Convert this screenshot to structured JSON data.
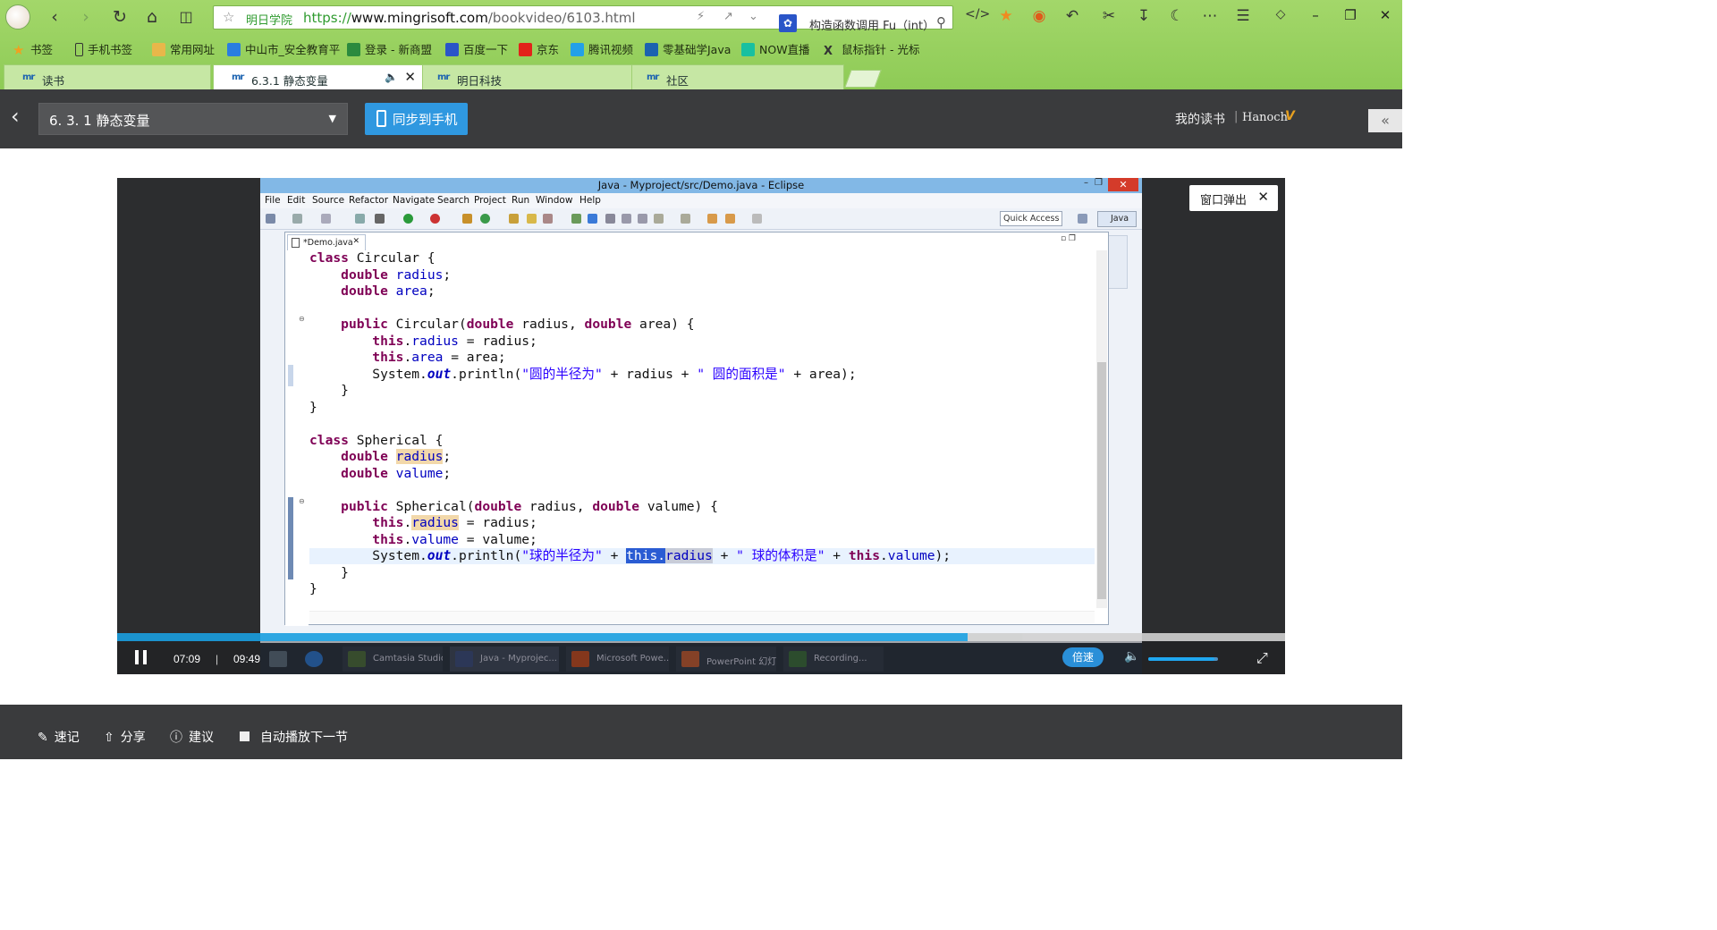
{
  "browser": {
    "address": {
      "site_name": "明日学院",
      "url_scheme": "https://",
      "url_host": "www.mingrisoft.com",
      "url_path": "/bookvideo/6103.html"
    },
    "search": {
      "engine_icon": "paw-icon",
      "query": "构造函数调用 Fu（int）"
    },
    "bookmarks": [
      {
        "label": "书签",
        "icon": "star-icon",
        "color": "#f0a020"
      },
      {
        "label": "手机书签",
        "icon": "phone-icon",
        "color": "#333333"
      },
      {
        "label": "常用网址",
        "icon": "folder-icon",
        "color": "#e8b74a"
      },
      {
        "label": "中山市_安全教育平",
        "icon": "site-icon",
        "color": "#2a7de0"
      },
      {
        "label": "登录 - 新商盟",
        "icon": "site-icon",
        "color": "#2b8a3e"
      },
      {
        "label": "百度一下",
        "icon": "paw-icon",
        "color": "#2a55c8"
      },
      {
        "label": "京东",
        "icon": "jd-icon",
        "color": "#e2231a"
      },
      {
        "label": "腾讯视频",
        "icon": "play-icon",
        "color": "#23a0e8"
      },
      {
        "label": "零基础学Java",
        "icon": "mr-icon",
        "color": "#1b62b0"
      },
      {
        "label": "NOW直播",
        "icon": "now-icon",
        "color": "#18c0a0"
      },
      {
        "label": "鼠标指针 - 光标",
        "icon": "x-icon",
        "color": "#333333"
      }
    ],
    "tabs": [
      {
        "label": "读书",
        "active": false
      },
      {
        "label": "6.3.1 静态变量",
        "active": true
      },
      {
        "label": "明日科技",
        "active": false
      },
      {
        "label": "社区",
        "active": false
      }
    ]
  },
  "header": {
    "chapter": "6. 3. 1  静态变量",
    "sync_label": "同步到手机",
    "mybook_label": "我的读书",
    "separator": "|",
    "user_name": "Hanoch",
    "vip_badge": "V"
  },
  "video": {
    "popout_label": "窗口弹出",
    "current_time": "07:09",
    "time_separator": "|",
    "total_time": "09:49",
    "progress": 0.728,
    "speed_label": "倍速",
    "volume": 0.95
  },
  "eclipse": {
    "title": "Java - Myproject/src/Demo.java - Eclipse",
    "menu": [
      "File",
      "Edit",
      "Source",
      "Refactor",
      "Navigate",
      "Search",
      "Project",
      "Run",
      "Window",
      "Help"
    ],
    "quick_access": "Quick Access",
    "perspective": "Java",
    "editor_tab": "*Demo.java",
    "taskbar_items": [
      {
        "label": "Camtasia Studio...",
        "color": "#4a6a3a"
      },
      {
        "label": "Java - Myprojec...",
        "color": "#3a4a7a"
      },
      {
        "label": "Microsoft Powe...",
        "color": "#c04a20"
      },
      {
        "label": "PowerPoint 幻灯...",
        "color": "#c05a30"
      },
      {
        "label": "Recording...",
        "color": "#3a6a3a"
      }
    ]
  },
  "footer": {
    "note_label": "速记",
    "share_label": "分享",
    "suggest_label": "建议",
    "autoplay_label": "自动播放下一节"
  }
}
